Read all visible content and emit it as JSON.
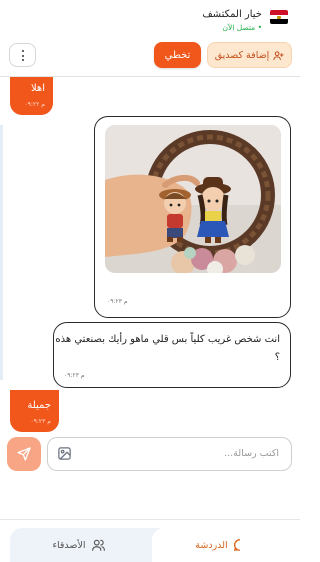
{
  "header": {
    "user_name": "خيار المكتشف",
    "status": "• متصل الآن",
    "skip_label": "تخطي",
    "add_friend_label": "إضافة كصديق"
  },
  "messages": [
    {
      "from": "other",
      "text": "اهلا",
      "time": "م ٠٩:٢٢"
    },
    {
      "from": "me",
      "type": "image",
      "time": "م ٠٩:٢٣"
    },
    {
      "from": "me",
      "text": "انت شخص غريب كلياً بس قلي ماهو رأيك بصنعتي هذه ؟",
      "time": "م ٠٩:٢٣"
    },
    {
      "from": "other",
      "text": "جميلة",
      "time": "م ٠٩:٢٣"
    }
  ],
  "composer": {
    "placeholder": "اكتب رسالة..."
  },
  "tabs": {
    "chat": "الدردشة",
    "friends": "الأصدقاء"
  },
  "colors": {
    "accent": "#f1561a",
    "flag_red": "#ce1126",
    "flag_black": "#000000",
    "status_green": "#22b14c"
  }
}
